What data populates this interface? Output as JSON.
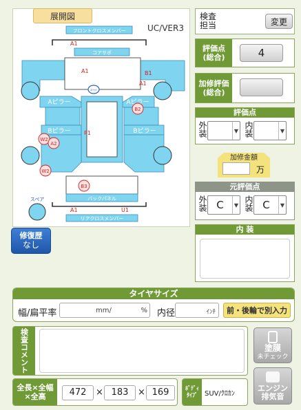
{
  "diagram": {
    "header_label": "展開図",
    "model_label": "UC/VER3",
    "front_cross": "フロントクロスメンバー",
    "core_support": "コアサポ",
    "a_pillar_l": "Aピラー",
    "a_pillar_r": "Aピラー",
    "b_pillar_l": "Bピラー",
    "b_pillar_r": "Bピラー",
    "back_panel": "バックパネル",
    "rear_cross": "リアクロスメンバー",
    "spare": "スペア",
    "center_mark": "ｽﾄﾗｯﾄ",
    "marks": {
      "a1_top": "A1",
      "a1_mid": "A1",
      "b1": "B1",
      "a1_right": "A1",
      "b2": "B2",
      "p1": "P1",
      "w2_upper": "W2",
      "a2": "A2",
      "w2_lower": "W2",
      "b3": "B3",
      "a1_bottom": "A1",
      "u1": "U1"
    }
  },
  "repair_history": {
    "line1": "修復歴",
    "line2": "なし"
  },
  "inspector": {
    "label_line1": "検査",
    "label_line2": "担当",
    "change_button": "変更"
  },
  "rating": {
    "label_line1": "評価点",
    "label_line2": "(総合)",
    "value": "4"
  },
  "repair_rating": {
    "label_line1": "加修評価",
    "label_line2": "(総合)",
    "value": ""
  },
  "evaluation": {
    "header": "評価点",
    "exterior_label": "外装",
    "interior_label": "内装",
    "exterior_value": "",
    "interior_value": ""
  },
  "repair_cost": {
    "label": "加修金額",
    "value": "",
    "unit": "万"
  },
  "original_evaluation": {
    "header": "元評価点",
    "exterior_label": "外装",
    "interior_label": "内装",
    "exterior_value": "C",
    "interior_value": "C"
  },
  "interior_panel": {
    "header": "内 装",
    "text": ""
  },
  "tire": {
    "header": "タイヤサイズ",
    "width_ratio_label": "幅/扁平率",
    "width_value": "",
    "width_unit": "mm/",
    "ratio_value": "",
    "ratio_unit": "%",
    "inner_dia_label": "内径",
    "inner_dia_value": "",
    "inner_dia_unit": "ｲﾝﾁ",
    "separate_button": "前・後輪で別入力"
  },
  "comment": {
    "label": "検査コメント",
    "text": ""
  },
  "paint_check": {
    "line1": "塗膜",
    "line2": "未チェック"
  },
  "dimensions": {
    "label_line1": "全長×全幅",
    "label_line2": "×全高",
    "length": "472",
    "width": "183",
    "height": "169",
    "times1": "×",
    "times2": "×"
  },
  "body_type": {
    "label_line1": "ﾎﾞﾃﾞｨ",
    "label_line2": "ﾀｲﾌﾟ",
    "value": "SUV/ｸﾛｶﾝ"
  },
  "engine_exhaust": {
    "line1": "エンジン",
    "line2": "排気音"
  },
  "colors": {
    "panel_green": "#6f9a36",
    "diagram_blue": "#7fd4f0",
    "repair_blue": "#2b62b8",
    "mark_red": "#d81b1b",
    "note_yellow": "#f4e27c"
  }
}
